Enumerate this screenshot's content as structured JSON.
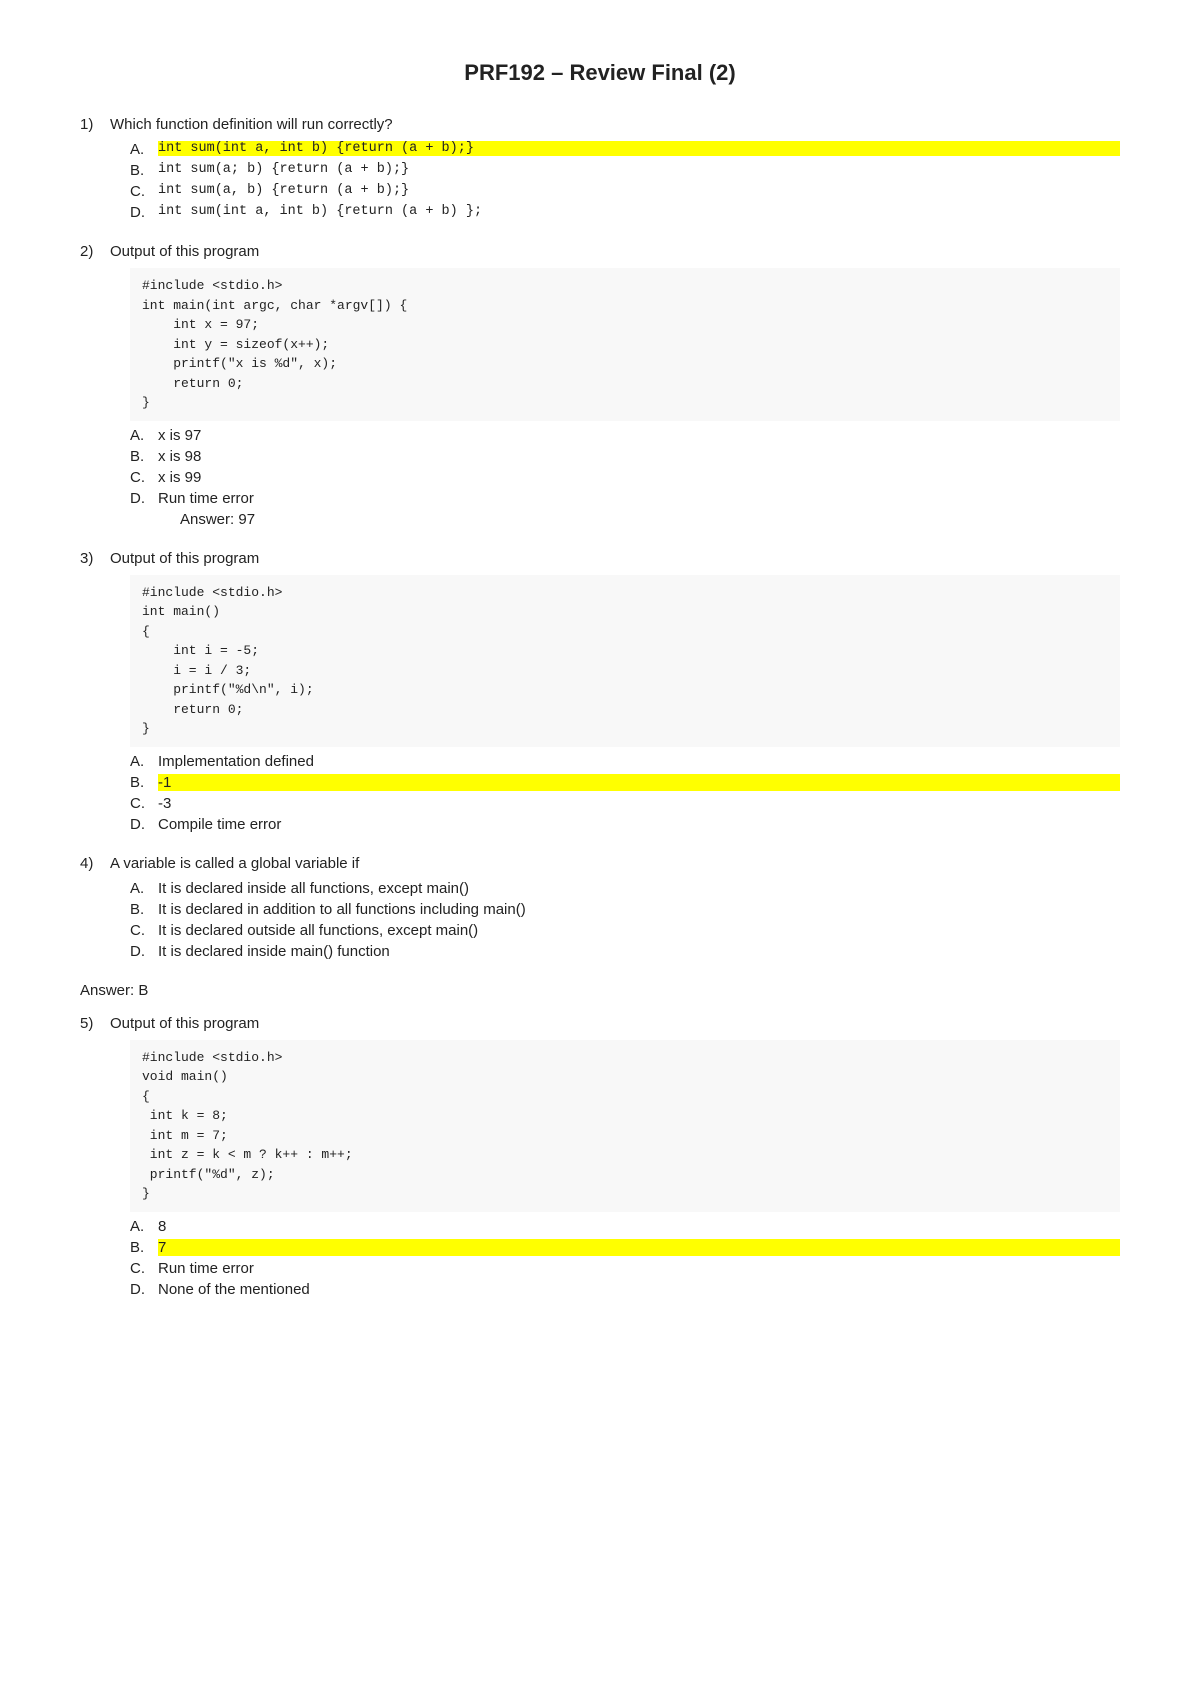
{
  "title": "PRF192 – Review Final (2)",
  "questions": [
    {
      "num": "1)",
      "text": "Which function definition will run correctly?",
      "options": [
        {
          "label": "A.",
          "text": "int sum(int a, int b)   {return (a + b);}",
          "highlight": true,
          "code": false
        },
        {
          "label": "B.",
          "text": "int sum(a; b) {return (a + b);}",
          "highlight": false,
          "code": false
        },
        {
          "label": "C.",
          "text": "int sum(a, b)   {return (a + b);}",
          "highlight": false,
          "code": false
        },
        {
          "label": "D.",
          "text": "int sum(int a, int b)   {return (a + b) };",
          "highlight": false,
          "code": false
        }
      ],
      "code": null,
      "answer": null
    },
    {
      "num": "2)",
      "text": "Output of this program",
      "code": "#include <stdio.h>\nint main(int argc, char *argv[]) {\n    int x = 97;\n    int y = sizeof(x++);\n    printf(\"x is %d\", x);\n    return 0;\n}",
      "options": [
        {
          "label": "A.",
          "text": "x is 97",
          "highlight": false
        },
        {
          "label": "B.",
          "text": "x is 98",
          "highlight": false
        },
        {
          "label": "C.",
          "text": "x is 99",
          "highlight": false
        },
        {
          "label": "D.",
          "text": "Run time error",
          "highlight": false
        }
      ],
      "answer": "Answer: 97"
    },
    {
      "num": "3)",
      "text": "Output of this program",
      "code": "#include <stdio.h>\nint main()\n{\n    int i = -5;\n    i = i / 3;\n    printf(\"%d\\n\", i);\n    return 0;\n}",
      "options": [
        {
          "label": "A.",
          "text": "Implementation defined",
          "highlight": false
        },
        {
          "label": "B.",
          "text": "-1",
          "highlight": true
        },
        {
          "label": "C.",
          "text": "-3",
          "highlight": false
        },
        {
          "label": "D.",
          "text": "Compile time error",
          "highlight": false
        }
      ],
      "answer": null
    },
    {
      "num": "4)",
      "text": "A variable is called a global variable if",
      "code": null,
      "options": [
        {
          "label": "A.",
          "text": "It is declared inside all functions, except main()",
          "highlight": false
        },
        {
          "label": "B.",
          "text": "It is declared in addition to all functions including main()",
          "highlight": false
        },
        {
          "label": "C.",
          "text": "It is declared outside all functions, except main()",
          "highlight": false
        },
        {
          "label": "D.",
          "text": "It is declared inside main() function",
          "highlight": false
        }
      ],
      "answer": null
    }
  ],
  "answer_standalone": "Answer: B",
  "question5": {
    "num": "5)",
    "text": "Output of this program",
    "code": "#include <stdio.h>\nvoid main()\n{\n int k = 8;\n int m = 7;\n int z = k < m ? k++ : m++;\n printf(\"%d\", z);\n}",
    "options": [
      {
        "label": "A.",
        "text": "8",
        "highlight": false
      },
      {
        "label": "B.",
        "text": "7",
        "highlight": true
      },
      {
        "label": "C.",
        "text": "Run time error",
        "highlight": false
      },
      {
        "label": "D.",
        "text": "None of the mentioned",
        "highlight": false
      }
    ]
  }
}
